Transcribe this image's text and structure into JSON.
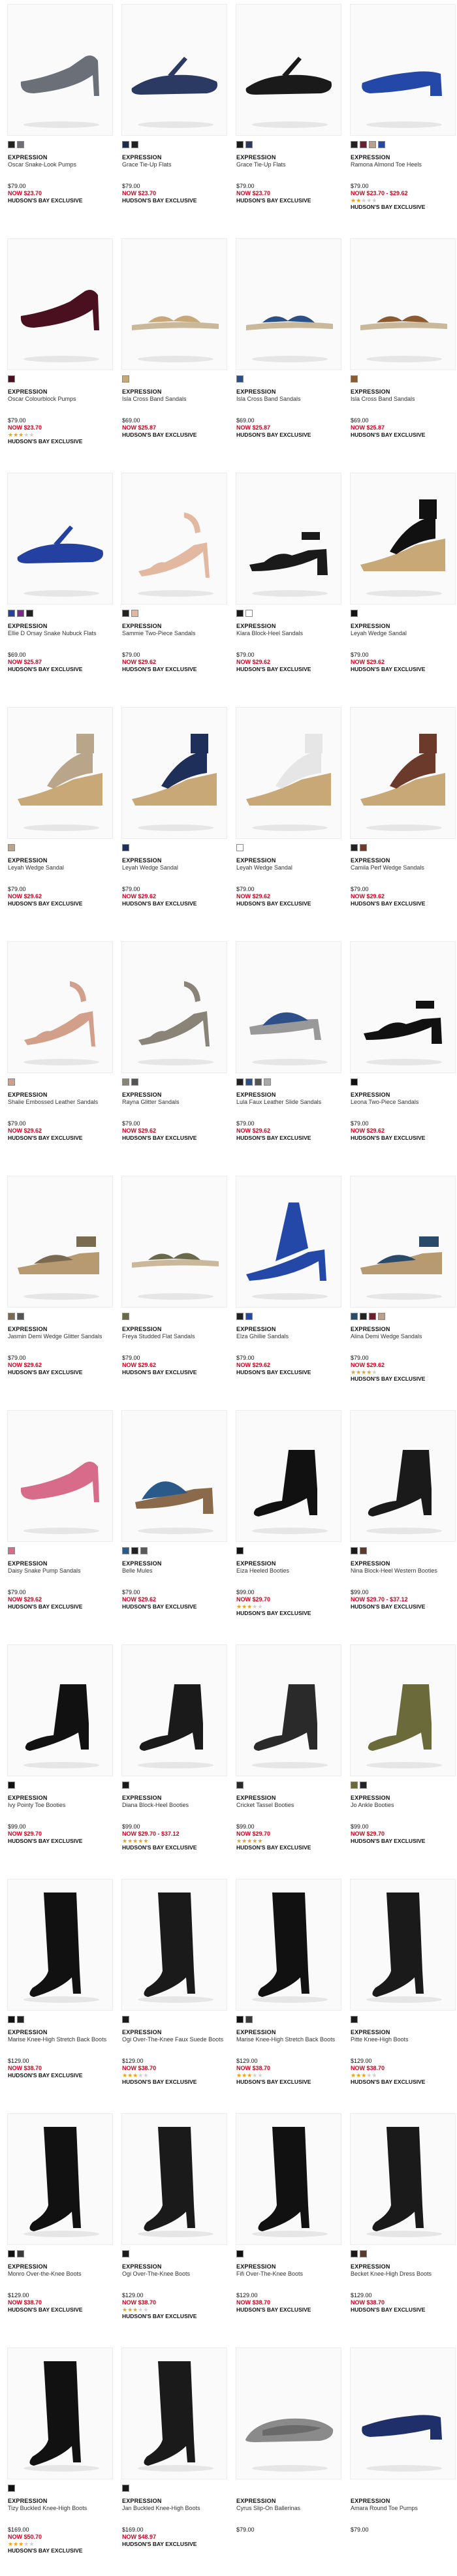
{
  "colors": {
    "sale": "#d0021b",
    "star": "#e8a317"
  },
  "labels": {
    "now_prefix": "NOW",
    "exclusive": "HUDSON'S BAY EXCLUSIVE"
  },
  "products": [
    {
      "brand": "EXPRESSION",
      "name": "Oscar Snake-Look Pumps",
      "price": "$79.00",
      "sale": "$23.70",
      "rating": 0,
      "exclusive": true,
      "icon": "pump-heel-icon",
      "shoe_color": "#6a6f78",
      "swatches": [
        "#222222",
        "#6a6f78"
      ]
    },
    {
      "brand": "EXPRESSION",
      "name": "Grace Tie-Up Flats",
      "price": "$79.00",
      "sale": "$23.70",
      "rating": 0,
      "exclusive": true,
      "icon": "flat-shoe-icon",
      "shoe_color": "#2b3a63",
      "swatches": [
        "#1b2a50",
        "#222222"
      ]
    },
    {
      "brand": "EXPRESSION",
      "name": "Grace Tie-Up Flats",
      "price": "$79.00",
      "sale": "$23.70",
      "rating": 0,
      "exclusive": true,
      "icon": "flat-shoe-icon",
      "shoe_color": "#1a1a1a",
      "swatches": [
        "#1a1a1a",
        "#2b3a63"
      ]
    },
    {
      "brand": "EXPRESSION",
      "name": "Ramona Almond Toe Heels",
      "price": "$79.00",
      "sale": "$23.70 - $29.62",
      "rating": 2,
      "exclusive": true,
      "icon": "block-heel-icon",
      "shoe_color": "#2448a8",
      "swatches": [
        "#222222",
        "#6b2030",
        "#b9a08c",
        "#2448a8"
      ]
    },
    {
      "brand": "EXPRESSION",
      "name": "Oscar Colourblock Pumps",
      "price": "$79.00",
      "sale": "$23.70",
      "rating": 3,
      "exclusive": true,
      "icon": "pump-heel-icon",
      "shoe_color": "#4a1020",
      "swatches": [
        "#4a1020"
      ]
    },
    {
      "brand": "EXPRESSION",
      "name": "Isla Cross Band Sandals",
      "price": "$69.00",
      "sale": "$25.87",
      "rating": 0,
      "exclusive": true,
      "icon": "flat-sandal-icon",
      "shoe_color": "#c8a878",
      "swatches": [
        "#c8a878"
      ]
    },
    {
      "brand": "EXPRESSION",
      "name": "Isla Cross Band Sandals",
      "price": "$69.00",
      "sale": "$25.87",
      "rating": 0,
      "exclusive": true,
      "icon": "flat-sandal-icon",
      "shoe_color": "#2c4f86",
      "swatches": [
        "#2c4f86"
      ]
    },
    {
      "brand": "EXPRESSION",
      "name": "Isla Cross Band Sandals",
      "price": "$69.00",
      "sale": "$25.87",
      "rating": 0,
      "exclusive": true,
      "icon": "flat-sandal-icon",
      "shoe_color": "#8a5a30",
      "swatches": [
        "#8a5a30"
      ]
    },
    {
      "brand": "EXPRESSION",
      "name": "Ellie D Orsay Snake Nubuck Flats",
      "price": "$69.00",
      "sale": "$25.87",
      "rating": 0,
      "exclusive": true,
      "icon": "flat-shoe-icon",
      "shoe_color": "#2440a0",
      "swatches": [
        "#2440a0",
        "#7a2a8a",
        "#222222"
      ]
    },
    {
      "brand": "EXPRESSION",
      "name": "Sammie Two-Piece Sandals",
      "price": "$79.00",
      "sale": "$29.62",
      "rating": 0,
      "exclusive": true,
      "icon": "heel-sandal-icon",
      "shoe_color": "#e2b8a0",
      "swatches": [
        "#222222",
        "#e2b8a0"
      ]
    },
    {
      "brand": "EXPRESSION",
      "name": "Klara Block-Heel Sandals",
      "price": "$79.00",
      "sale": "$29.62",
      "rating": 0,
      "exclusive": true,
      "icon": "block-sandal-icon",
      "shoe_color": "#1a1a1a",
      "swatches": [
        "#1a1a1a",
        "#ffffff"
      ]
    },
    {
      "brand": "EXPRESSION",
      "name": "Leyah Wedge Sandal",
      "price": "$79.00",
      "sale": "$29.62",
      "rating": 0,
      "exclusive": true,
      "icon": "wedge-sandal-icon",
      "shoe_color": "#111111",
      "swatches": [
        "#111111"
      ]
    },
    {
      "brand": "EXPRESSION",
      "name": "Leyah Wedge Sandal",
      "price": "$79.00",
      "sale": "$29.62",
      "rating": 0,
      "exclusive": true,
      "icon": "wedge-sandal-icon",
      "shoe_color": "#b8a58a",
      "swatches": [
        "#b8a58a"
      ]
    },
    {
      "brand": "EXPRESSION",
      "name": "Leyah Wedge Sandal",
      "price": "$79.00",
      "sale": "$29.62",
      "rating": 0,
      "exclusive": true,
      "icon": "wedge-sandal-icon",
      "shoe_color": "#1e2f5a",
      "swatches": [
        "#1e2f5a"
      ]
    },
    {
      "brand": "EXPRESSION",
      "name": "Leyah Wedge Sandal",
      "price": "$79.00",
      "sale": "$29.62",
      "rating": 0,
      "exclusive": true,
      "icon": "wedge-sandal-icon",
      "shoe_color": "#e6e6e6",
      "swatches": [
        "#ffffff"
      ]
    },
    {
      "brand": "EXPRESSION",
      "name": "Camila Perf Wedge Sandals",
      "price": "$79.00",
      "sale": "$29.62",
      "rating": 0,
      "exclusive": true,
      "icon": "wedge-sandal-icon",
      "shoe_color": "#6b3a2a",
      "swatches": [
        "#222222",
        "#6b3a2a"
      ]
    },
    {
      "brand": "EXPRESSION",
      "name": "Shalie Embossed Leather Sandals",
      "price": "$79.00",
      "sale": "$29.62",
      "rating": 0,
      "exclusive": true,
      "icon": "heel-sandal-icon",
      "shoe_color": "#d2a08a",
      "swatches": [
        "#d2a08a"
      ]
    },
    {
      "brand": "EXPRESSION",
      "name": "Rayna Glitter Sandals",
      "price": "$79.00",
      "sale": "$29.62",
      "rating": 0,
      "exclusive": true,
      "icon": "heel-sandal-icon",
      "shoe_color": "#8a8478",
      "swatches": [
        "#8a8478",
        "#555555"
      ]
    },
    {
      "brand": "EXPRESSION",
      "name": "Lula Faux Leather Slide Sandals",
      "price": "$79.00",
      "sale": "$29.62",
      "rating": 0,
      "exclusive": true,
      "icon": "slide-sandal-icon",
      "shoe_color": "#2d4f8a",
      "swatches": [
        "#222222",
        "#2d4f8a",
        "#555555",
        "#aaaaaa"
      ]
    },
    {
      "brand": "EXPRESSION",
      "name": "Leona Two-Piece Sandals",
      "price": "$79.00",
      "sale": "$29.62",
      "rating": 0,
      "exclusive": true,
      "icon": "block-sandal-icon",
      "shoe_color": "#111111",
      "swatches": [
        "#111111"
      ]
    },
    {
      "brand": "EXPRESSION",
      "name": "Jasmin Demi Wedge Glitter Sandals",
      "price": "$79.00",
      "sale": "$29.62",
      "rating": 0,
      "exclusive": true,
      "icon": "demi-wedge-icon",
      "shoe_color": "#7a6a50",
      "swatches": [
        "#7a6a50",
        "#555555"
      ]
    },
    {
      "brand": "EXPRESSION",
      "name": "Freya Studded Flat Sandals",
      "price": "$79.00",
      "sale": "$29.62",
      "rating": 0,
      "exclusive": true,
      "icon": "flat-sandal-icon",
      "shoe_color": "#6a6a4a",
      "swatches": [
        "#6a6a4a"
      ]
    },
    {
      "brand": "EXPRESSION",
      "name": "Elza Ghillie Sandals",
      "price": "$79.00",
      "sale": "$29.62",
      "rating": 0,
      "exclusive": true,
      "icon": "ghillie-sandal-icon",
      "shoe_color": "#2448a8",
      "swatches": [
        "#222222",
        "#2448a8"
      ]
    },
    {
      "brand": "EXPRESSION",
      "name": "Alina Demi Wedge Sandals",
      "price": "$79.00",
      "sale": "$29.62",
      "rating": 4,
      "exclusive": true,
      "icon": "demi-wedge-icon",
      "shoe_color": "#2a4a6a",
      "swatches": [
        "#2a4a6a",
        "#222222",
        "#6b2030",
        "#b9a08c"
      ]
    },
    {
      "brand": "EXPRESSION",
      "name": "Daisy Snake Pump Sandals",
      "price": "$79.00",
      "sale": "$29.62",
      "rating": 0,
      "exclusive": true,
      "icon": "pump-heel-icon",
      "shoe_color": "#d86a8a",
      "swatches": [
        "#d86a8a"
      ]
    },
    {
      "brand": "EXPRESSION",
      "name": "Belle Mules",
      "price": "$79.00",
      "sale": "$29.62",
      "rating": 0,
      "exclusive": true,
      "icon": "mule-icon",
      "shoe_color": "#2a5a8a",
      "swatches": [
        "#2a5a8a",
        "#222222",
        "#5a5a5a"
      ]
    },
    {
      "brand": "EXPRESSION",
      "name": "Eiza Heeled Booties",
      "price": "$99.00",
      "sale": "$29.70",
      "rating": 3,
      "exclusive": true,
      "icon": "ankle-bootie-icon",
      "shoe_color": "#111111",
      "swatches": [
        "#111111"
      ]
    },
    {
      "brand": "EXPRESSION",
      "name": "Nina Block-Heel Western Booties",
      "price": "$99.00",
      "sale": "$29.70 - $37.12",
      "rating": 0,
      "exclusive": true,
      "icon": "ankle-bootie-icon",
      "shoe_color": "#1a1a1a",
      "swatches": [
        "#1a1a1a",
        "#5a3a2a"
      ]
    },
    {
      "brand": "EXPRESSION",
      "name": "Ivy Pointy Toe Booties",
      "price": "$99.00",
      "sale": "$29.70",
      "rating": 0,
      "exclusive": true,
      "icon": "ankle-bootie-icon",
      "shoe_color": "#111111",
      "swatches": [
        "#111111"
      ]
    },
    {
      "brand": "EXPRESSION",
      "name": "Diana Block-Heel Booties",
      "price": "$99.00",
      "sale": "$29.70 - $37.12",
      "rating": 5,
      "exclusive": true,
      "icon": "ankle-bootie-icon",
      "shoe_color": "#1a1a1a",
      "swatches": [
        "#1a1a1a"
      ]
    },
    {
      "brand": "EXPRESSION",
      "name": "Cricket Tassel Booties",
      "price": "$99.00",
      "sale": "$29.70",
      "rating": 5,
      "exclusive": true,
      "icon": "ankle-bootie-icon",
      "shoe_color": "#2a2a2a",
      "swatches": [
        "#2a2a2a"
      ]
    },
    {
      "brand": "EXPRESSION",
      "name": "Jo Ankle Booties",
      "price": "$99.00",
      "sale": "$29.70",
      "rating": 0,
      "exclusive": true,
      "icon": "ankle-bootie-icon",
      "shoe_color": "#6a6a3a",
      "swatches": [
        "#6a6a3a",
        "#222222"
      ]
    },
    {
      "brand": "EXPRESSION",
      "name": "Marise Knee-High Stretch Back Boots",
      "price": "$129.00",
      "sale": "$38.70",
      "rating": 0,
      "exclusive": true,
      "icon": "tall-boot-icon",
      "shoe_color": "#111111",
      "swatches": [
        "#111111",
        "#222222"
      ]
    },
    {
      "brand": "EXPRESSION",
      "name": "Ogi Over-The-Knee Faux Suede Boots",
      "price": "$129.00",
      "sale": "$38.70",
      "rating": 3,
      "exclusive": true,
      "icon": "tall-boot-icon",
      "shoe_color": "#1a1a1a",
      "swatches": [
        "#1a1a1a"
      ]
    },
    {
      "brand": "EXPRESSION",
      "name": "Marise Knee-High Stretch Back Boots",
      "price": "$129.00",
      "sale": "$38.70",
      "rating": 3,
      "exclusive": true,
      "icon": "tall-boot-icon",
      "shoe_color": "#111111",
      "swatches": [
        "#111111",
        "#3a3a3a"
      ]
    },
    {
      "brand": "EXPRESSION",
      "name": "Pitte Knee-High Boots",
      "price": "$129.00",
      "sale": "$38.70",
      "rating": 3,
      "exclusive": true,
      "icon": "tall-boot-icon",
      "shoe_color": "#1a1a1a",
      "swatches": [
        "#1a1a1a"
      ]
    },
    {
      "brand": "EXPRESSION",
      "name": "Monro Over-the-Knee Boots",
      "price": "$129.00",
      "sale": "$38.70",
      "rating": 0,
      "exclusive": true,
      "icon": "tall-boot-icon",
      "shoe_color": "#111111",
      "swatches": [
        "#111111",
        "#3a3a3a"
      ]
    },
    {
      "brand": "EXPRESSION",
      "name": "Ogi Over-The-Knee Boots",
      "price": "$129.00",
      "sale": "$38.70",
      "rating": 3,
      "exclusive": true,
      "icon": "tall-boot-icon",
      "shoe_color": "#1a1a1a",
      "swatches": [
        "#1a1a1a"
      ]
    },
    {
      "brand": "EXPRESSION",
      "name": "Fifi Over-The-Knee Boots",
      "price": "$129.00",
      "sale": "$38.70",
      "rating": 0,
      "exclusive": true,
      "icon": "tall-boot-icon",
      "shoe_color": "#111111",
      "swatches": [
        "#111111"
      ]
    },
    {
      "brand": "EXPRESSION",
      "name": "Becket Knee-High Dress Boots",
      "price": "$129.00",
      "sale": "$38.70",
      "rating": 0,
      "exclusive": true,
      "icon": "tall-boot-icon",
      "shoe_color": "#1a1a1a",
      "swatches": [
        "#1a1a1a",
        "#5a3a2a"
      ]
    },
    {
      "brand": "EXPRESSION",
      "name": "Tizy Buckled Knee-High Boots",
      "price": "$169.00",
      "sale": "$50.70",
      "rating": 3,
      "exclusive": true,
      "icon": "tall-boot-icon",
      "shoe_color": "#111111",
      "swatches": [
        "#111111"
      ]
    },
    {
      "brand": "EXPRESSION",
      "name": "Jan Buckled Knee-High Boots",
      "price": "$169.00",
      "sale": "$48.97",
      "rating": 0,
      "exclusive": true,
      "icon": "tall-boot-icon",
      "shoe_color": "#1a1a1a",
      "swatches": [
        "#1a1a1a"
      ]
    },
    {
      "brand": "EXPRESSION",
      "name": "Cyrus Slip-On Ballerinas",
      "price": "$79.00",
      "sale": "",
      "rating": 0,
      "exclusive": false,
      "icon": "ballerina-flat-icon",
      "shoe_color": "#8a8a8a",
      "swatches": []
    },
    {
      "brand": "EXPRESSION",
      "name": "Amara Round Toe Pumps",
      "price": "$79.00",
      "sale": "",
      "rating": 0,
      "exclusive": false,
      "icon": "block-heel-icon",
      "shoe_color": "#1e2f6a",
      "swatches": []
    }
  ]
}
